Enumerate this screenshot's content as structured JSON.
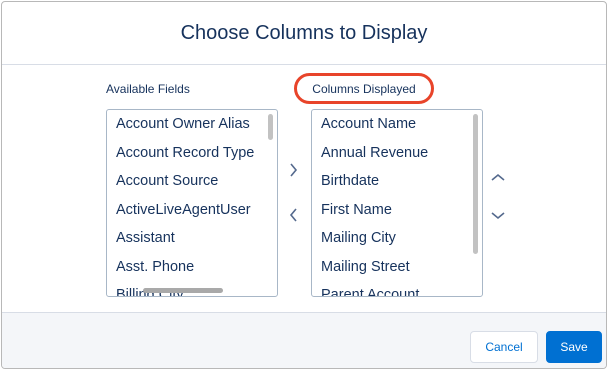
{
  "modal": {
    "title": "Choose Columns to Display"
  },
  "available": {
    "label": "Available Fields",
    "items": [
      "Account Owner Alias",
      "Account Record Type",
      "Account Source",
      "ActiveLiveAgentUser",
      "Assistant",
      "Asst. Phone",
      "Billing City"
    ]
  },
  "displayed": {
    "label": "Columns Displayed",
    "items": [
      "Account Name",
      "Annual Revenue",
      "Birthdate",
      "First Name",
      "Mailing City",
      "Mailing Street",
      "Parent Account"
    ]
  },
  "controls": {
    "move_right_icon": "chevron-right-icon",
    "move_left_icon": "chevron-left-icon",
    "move_up_icon": "chevron-up-icon",
    "move_down_icon": "chevron-down-icon"
  },
  "footer": {
    "cancel_label": "Cancel",
    "save_label": "Save"
  },
  "colors": {
    "brand": "#0070d2",
    "text": "#16325c",
    "highlight_annotation": "#e8442a"
  }
}
